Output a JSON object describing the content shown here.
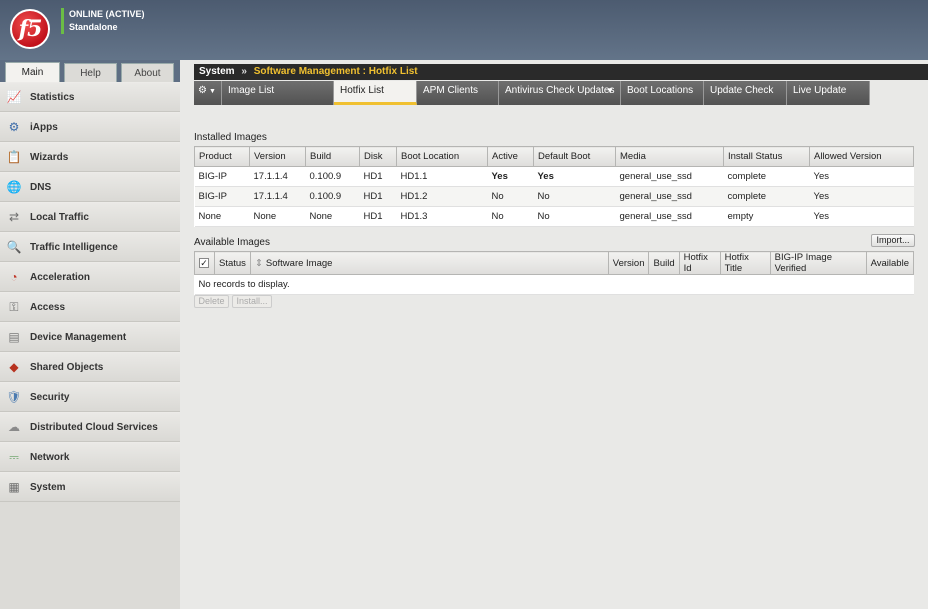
{
  "header": {
    "status_online": "ONLINE (ACTIVE)",
    "status_mode": "Standalone",
    "logo_text": "f5"
  },
  "main_tabs": [
    {
      "label": "Main",
      "active": true
    },
    {
      "label": "Help",
      "active": false
    },
    {
      "label": "About",
      "active": false
    }
  ],
  "sidebar": {
    "items": [
      {
        "label": "Statistics",
        "icon": "statistics-icon",
        "glyph": "📈",
        "color": "#b5492f"
      },
      {
        "label": "iApps",
        "icon": "iapps-icon",
        "glyph": "⚙",
        "color": "#3a6aa8"
      },
      {
        "label": "Wizards",
        "icon": "wizards-icon",
        "glyph": "📋",
        "color": "#c9a13b"
      },
      {
        "label": "DNS",
        "icon": "dns-icon",
        "glyph": "🌐",
        "color": "#2d6fb5"
      },
      {
        "label": "Local Traffic",
        "icon": "local-traffic-icon",
        "glyph": "⇄",
        "color": "#6d6d6d"
      },
      {
        "label": "Traffic Intelligence",
        "icon": "traffic-intelligence-icon",
        "glyph": "🔍",
        "color": "#6d6d6d"
      },
      {
        "label": "Acceleration",
        "icon": "acceleration-icon",
        "glyph": "◔",
        "color": "#c0392b"
      },
      {
        "label": "Access",
        "icon": "access-icon",
        "glyph": "⚿",
        "color": "#6d6d6d"
      },
      {
        "label": "Device Management",
        "icon": "device-management-icon",
        "glyph": "▤",
        "color": "#7a7a7a"
      },
      {
        "label": "Shared Objects",
        "icon": "shared-objects-icon",
        "glyph": "◆",
        "color": "#b7321f"
      },
      {
        "label": "Security",
        "icon": "security-icon",
        "glyph": "🛡",
        "color": "#4a7ab0"
      },
      {
        "label": "Distributed Cloud Services",
        "icon": "distributed-cloud-icon",
        "glyph": "☁",
        "color": "#8a8a8a"
      },
      {
        "label": "Network",
        "icon": "network-icon",
        "glyph": "⎓",
        "color": "#3b8a3b"
      },
      {
        "label": "System",
        "icon": "system-icon",
        "glyph": "▦",
        "color": "#6d6d6d"
      }
    ]
  },
  "breadcrumb": {
    "root": "System",
    "separator": "»",
    "path": "Software Management : Hotfix List"
  },
  "tabs": [
    {
      "label": "Image List",
      "active": false,
      "width": 112
    },
    {
      "label": "Hotfix List",
      "active": true,
      "width": 83
    },
    {
      "label": "APM Clients",
      "active": false,
      "width": 82
    },
    {
      "label": "Antivirus Check Updates",
      "active": false,
      "width": 122,
      "dropdown": true
    },
    {
      "label": "Boot Locations",
      "active": false,
      "width": 83
    },
    {
      "label": "Update Check",
      "active": false,
      "width": 83
    },
    {
      "label": "Live Update",
      "active": false,
      "width": 83
    }
  ],
  "installed": {
    "title": "Installed Images",
    "columns": [
      "Product",
      "Version",
      "Build",
      "Disk",
      "Boot Location",
      "Active",
      "Default Boot",
      "Media",
      "Install Status",
      "Allowed Version"
    ],
    "rows": [
      [
        "BIG-IP",
        "17.1.1.4",
        "0.100.9",
        "HD1",
        "HD1.1",
        "Yes",
        "Yes",
        "general_use_ssd",
        "complete",
        "Yes"
      ],
      [
        "BIG-IP",
        "17.1.1.4",
        "0.100.9",
        "HD1",
        "HD1.2",
        "No",
        "No",
        "general_use_ssd",
        "complete",
        "Yes"
      ],
      [
        "None",
        "None",
        "None",
        "HD1",
        "HD1.3",
        "No",
        "No",
        "general_use_ssd",
        "empty",
        "Yes"
      ]
    ]
  },
  "available": {
    "title": "Available Images",
    "import_label": "Import...",
    "columns": [
      "Status",
      "Software Image",
      "Version",
      "Build",
      "Hotfix Id",
      "Hotfix Title",
      "BIG-IP Image Verified",
      "Available"
    ],
    "empty_message": "No records to display.",
    "sort_glyph": "⇕",
    "delete_label": "Delete",
    "install_label": "Install..."
  },
  "colors": {
    "accent": "#f0c030",
    "header_bg": "#56657a",
    "link": "#1f4fa0"
  }
}
